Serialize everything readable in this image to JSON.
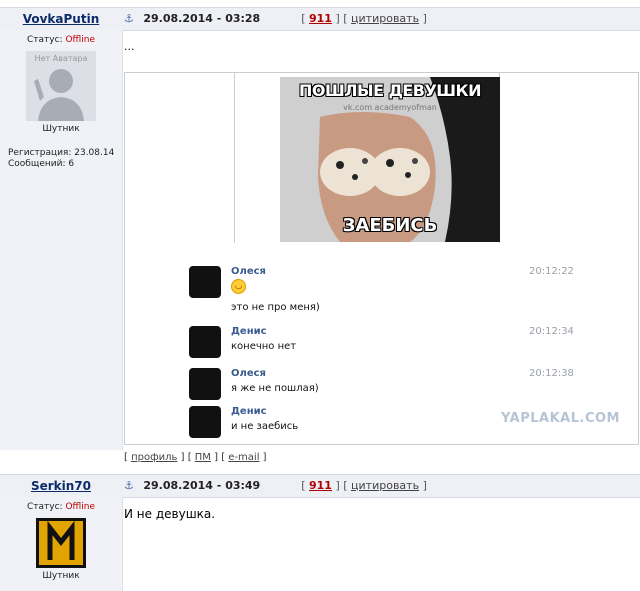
{
  "posts": [
    {
      "author": "VovkaPutin",
      "anchor_icon": "⚓",
      "date": "29.08.2014 - 03:28",
      "post_number": "911",
      "quote_label": "цитировать",
      "status_label": "Статус:",
      "status_value": "Offline",
      "avatar_label": "Нет Аватара",
      "rank": "Шутник",
      "registration": "Регистрация: 23.08.14",
      "messages": "Сообщений: 6",
      "text": "...",
      "image": {
        "title": "ПОШЛЫЕ ДЕВУШКИ",
        "subtitle": "vk.com academyofman",
        "bottom": "ЗАЕБИСЬ",
        "watermark": "YAPLAKAL.COM",
        "chat": [
          {
            "name": "Олеся",
            "time": "20:12:22",
            "text": "это не про меня)",
            "emoji": "😊"
          },
          {
            "name": "Денис",
            "time": "20:12:34",
            "text": "конечно нет"
          },
          {
            "name": "Олеся",
            "time": "20:12:38",
            "text": "я же не пошлая)"
          },
          {
            "name": "Денис",
            "time": "",
            "text": "и не заебись"
          }
        ]
      },
      "links": {
        "profile": "профиль",
        "pm": "ПМ",
        "email": "e-mail"
      }
    },
    {
      "author": "Serkin70",
      "anchor_icon": "⚓",
      "date": "29.08.2014 - 03:49",
      "post_number": "911",
      "quote_label": "цитировать",
      "status_label": "Статус:",
      "status_value": "Offline",
      "rank": "Шутник",
      "text": "И не девушка."
    }
  ],
  "colors": {
    "offline": "#c00000",
    "post_number": "#b00000",
    "header_bg": "#eef0f5",
    "sidebar_bg": "#f0f2f7"
  }
}
